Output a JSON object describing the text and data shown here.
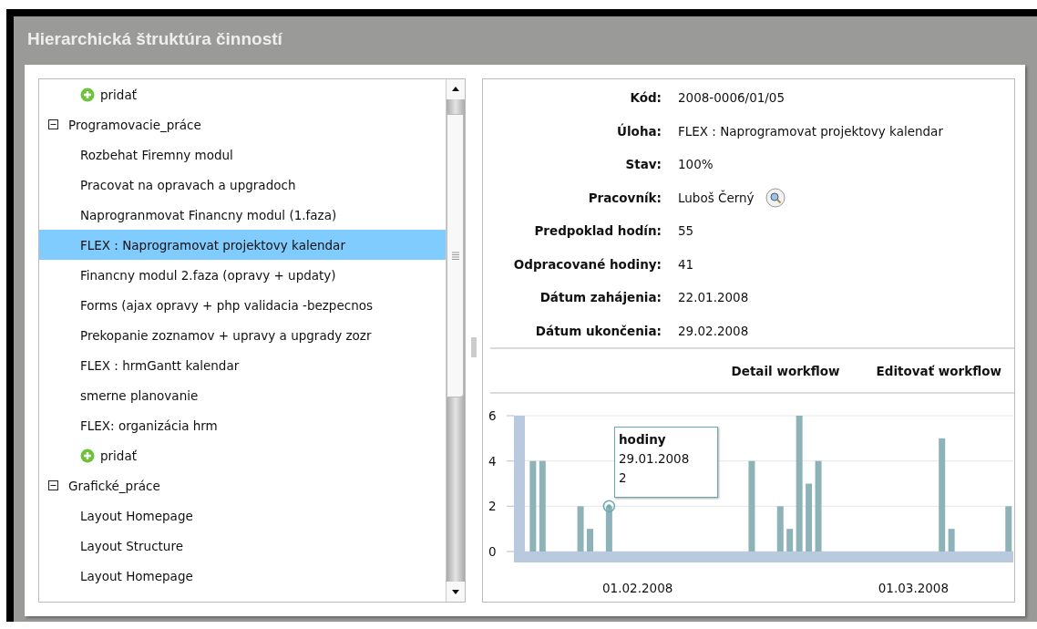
{
  "title": "Hierarchická štruktúra činností",
  "tree": [
    {
      "kind": "add",
      "label": "pridať"
    },
    {
      "kind": "group",
      "label": "Programovacie_práce",
      "expanded": true,
      "children": [
        {
          "kind": "task",
          "label": "Rozbehat Firemny modul",
          "selected": false
        },
        {
          "kind": "task",
          "label": "Pracovat na opravach a upgradoch",
          "selected": false
        },
        {
          "kind": "task",
          "label": "Naprogranmovat Financny modul (1.faza)",
          "selected": false
        },
        {
          "kind": "task",
          "label": "FLEX : Naprogramovat projektovy kalendar",
          "selected": true
        },
        {
          "kind": "task",
          "label": "Financny modul 2.faza (opravy + updaty)",
          "selected": false
        },
        {
          "kind": "task",
          "label": "Forms (ajax opravy + php validacia -bezpecnos",
          "selected": false
        },
        {
          "kind": "task",
          "label": "Prekopanie zoznamov + upravy a upgrady zozr",
          "selected": false
        },
        {
          "kind": "task",
          "label": "FLEX : hrmGantt kalendar",
          "selected": false
        },
        {
          "kind": "task",
          "label": "smerne planovanie",
          "selected": false
        },
        {
          "kind": "task",
          "label": "FLEX: organizácia hrm",
          "selected": false
        },
        {
          "kind": "add",
          "label": "pridať"
        }
      ]
    },
    {
      "kind": "group",
      "label": "Grafické_práce",
      "expanded": true,
      "children": [
        {
          "kind": "task",
          "label": "Layout Homepage",
          "selected": false
        },
        {
          "kind": "task",
          "label": "Layout Structure",
          "selected": false
        },
        {
          "kind": "task",
          "label": "Layout Homepage",
          "selected": false
        }
      ]
    }
  ],
  "details": [
    {
      "label": "Kód:",
      "value": "2008-0006/01/05"
    },
    {
      "label": "Úloha:",
      "value": "FLEX : Naprogramovat projektovy kalendar"
    },
    {
      "label": "Stav:",
      "value": "100%"
    },
    {
      "label": "Pracovník:",
      "value": "Luboš Černý",
      "kind": "person"
    },
    {
      "label": "Predpoklad hodín:",
      "value": "55"
    },
    {
      "label": "Odpracované hodiny:",
      "value": "41"
    },
    {
      "label": "Dátum zahájenia:",
      "value": "22.01.2008"
    },
    {
      "label": "Dátum ukončenia:",
      "value": "29.02.2008"
    }
  ],
  "actions": [
    "Detail workflow",
    "Editovať workflow"
  ],
  "chart": {
    "chart_data": {
      "type": "bar",
      "categories": [
        null,
        null,
        null,
        null,
        null,
        null,
        null,
        null,
        null,
        null,
        null,
        null,
        "01.02.2008",
        null,
        null,
        null,
        null,
        null,
        null,
        null,
        null,
        null,
        null,
        null,
        null,
        null,
        null,
        null,
        null,
        null,
        null,
        null,
        null,
        null,
        null,
        null,
        null,
        null,
        null,
        null,
        null,
        "01.03.2008",
        null,
        null,
        null,
        null,
        null,
        null,
        null,
        null,
        null,
        null
      ],
      "series": [
        {
          "name": "hodiny",
          "color": "#8db3b9",
          "values": [
            null,
            4,
            4,
            null,
            null,
            null,
            2,
            1,
            null,
            2,
            null,
            null,
            null,
            null,
            null,
            null,
            null,
            null,
            null,
            null,
            null,
            null,
            null,
            null,
            4,
            null,
            null,
            2,
            1,
            6,
            3,
            4,
            null,
            null,
            null,
            null,
            null,
            null,
            null,
            null,
            null,
            null,
            null,
            null,
            5,
            1,
            null,
            null,
            null,
            null,
            null,
            2
          ]
        }
      ],
      "ylim": [
        0,
        6
      ],
      "yticks": [
        0,
        2,
        4,
        6
      ]
    },
    "tooltip": {
      "date": "29.01.2008",
      "value": "2"
    }
  }
}
